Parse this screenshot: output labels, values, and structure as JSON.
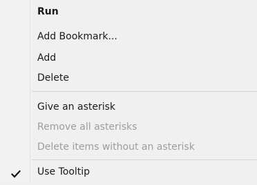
{
  "menu": {
    "items": [
      {
        "label": "Run",
        "bold": true,
        "disabled": false,
        "checked": false
      },
      {
        "label": "Add Bookmark...",
        "bold": false,
        "disabled": false,
        "checked": false
      },
      {
        "label": "Add",
        "bold": false,
        "disabled": false,
        "checked": false
      },
      {
        "label": "Delete",
        "bold": false,
        "disabled": false,
        "checked": false
      },
      {
        "label": "Give an asterisk",
        "bold": false,
        "disabled": false,
        "checked": false
      },
      {
        "label": "Remove all asterisks",
        "bold": false,
        "disabled": true,
        "checked": false
      },
      {
        "label": "Delete items without an asterisk",
        "bold": false,
        "disabled": true,
        "checked": false
      },
      {
        "label": "Use Tooltip",
        "bold": false,
        "disabled": false,
        "checked": true
      }
    ]
  },
  "icons": {
    "check": "checkmark-icon"
  },
  "colors": {
    "background": "#f0f0f0",
    "text": "#1a1a1a",
    "disabled_text": "#9d9d9d",
    "separator": "#d6d6d6"
  }
}
